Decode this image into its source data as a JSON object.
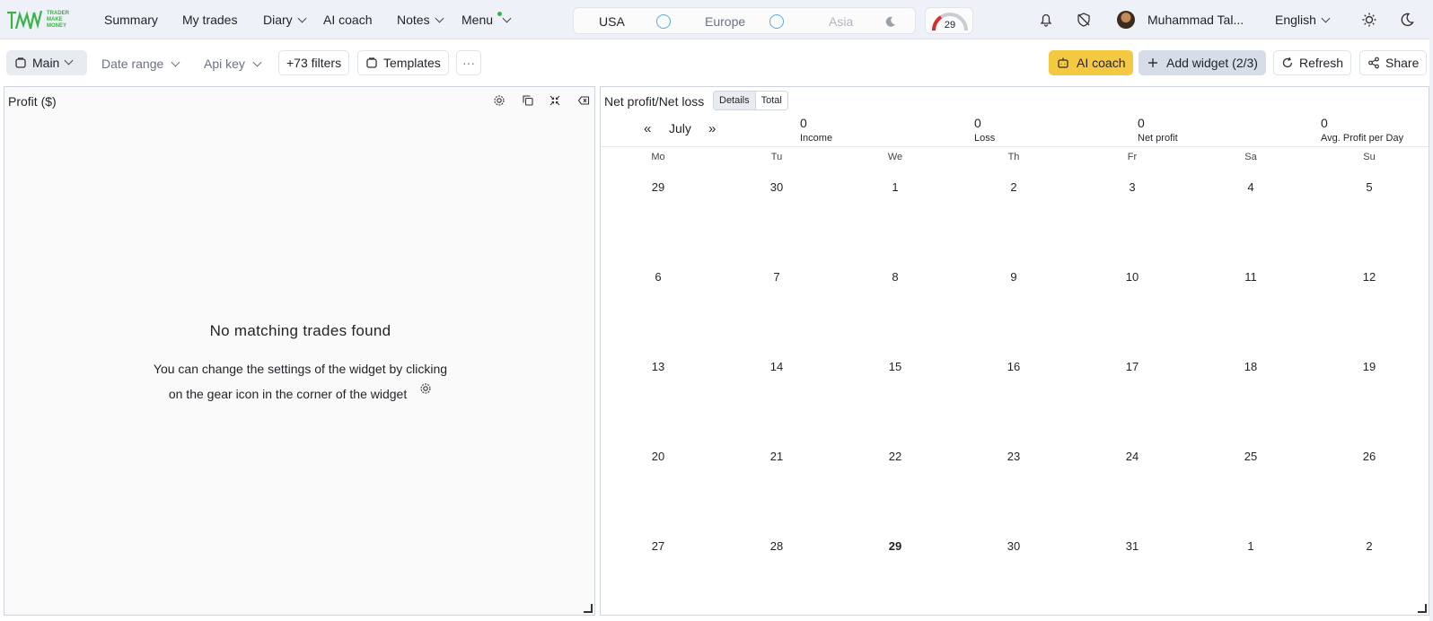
{
  "logo": {
    "text": "TRADER MAKE MONEY"
  },
  "nav": {
    "summary": "Summary",
    "my_trades": "My trades",
    "diary": "Diary",
    "ai_coach": "AI coach",
    "notes": "Notes",
    "menu": "Menu"
  },
  "sessions": {
    "usa": "USA",
    "europe": "Europe",
    "asia": "Asia"
  },
  "gauge": {
    "value": "29"
  },
  "user": {
    "name": "Muhammad Tal...",
    "language": "English"
  },
  "toolbar": {
    "main": "Main",
    "date_range": "Date range",
    "api_key": "Api key",
    "filters": "+73 filters",
    "templates": "Templates",
    "more": "···",
    "ai_coach": "AI coach",
    "add_widget": "Add widget (2/3)",
    "refresh": "Refresh",
    "share": "Share"
  },
  "colors": {
    "accent_yellow": "#f5c842",
    "add_widget_bg": "#d6dde8",
    "brand_green": "#3bb34a"
  },
  "profit_widget": {
    "title": "Profit ($)",
    "empty_title": "No matching trades found",
    "empty_line1": "You can change the settings of the widget by clicking",
    "empty_line2": "on the gear icon in the corner of the widget"
  },
  "calendar_widget": {
    "title": "Net profit/Net loss",
    "tabs": [
      "Details",
      "Total"
    ],
    "month": "July",
    "stats": [
      {
        "value": "0",
        "label": "Income"
      },
      {
        "value": "0",
        "label": "Loss"
      },
      {
        "value": "0",
        "label": "Net profit"
      },
      {
        "value": "0",
        "label": "Avg. Profit per Day"
      }
    ],
    "weekdays": [
      "Mo",
      "Tu",
      "We",
      "Th",
      "Fr",
      "Sa",
      "Su"
    ],
    "weeks": [
      [
        "29",
        "30",
        "1",
        "2",
        "3",
        "4",
        "5"
      ],
      [
        "6",
        "7",
        "8",
        "9",
        "10",
        "11",
        "12"
      ],
      [
        "13",
        "14",
        "15",
        "16",
        "17",
        "18",
        "19"
      ],
      [
        "20",
        "21",
        "22",
        "23",
        "24",
        "25",
        "26"
      ],
      [
        "27",
        "28",
        "29",
        "30",
        "31",
        "1",
        "2"
      ]
    ],
    "today": "29"
  }
}
